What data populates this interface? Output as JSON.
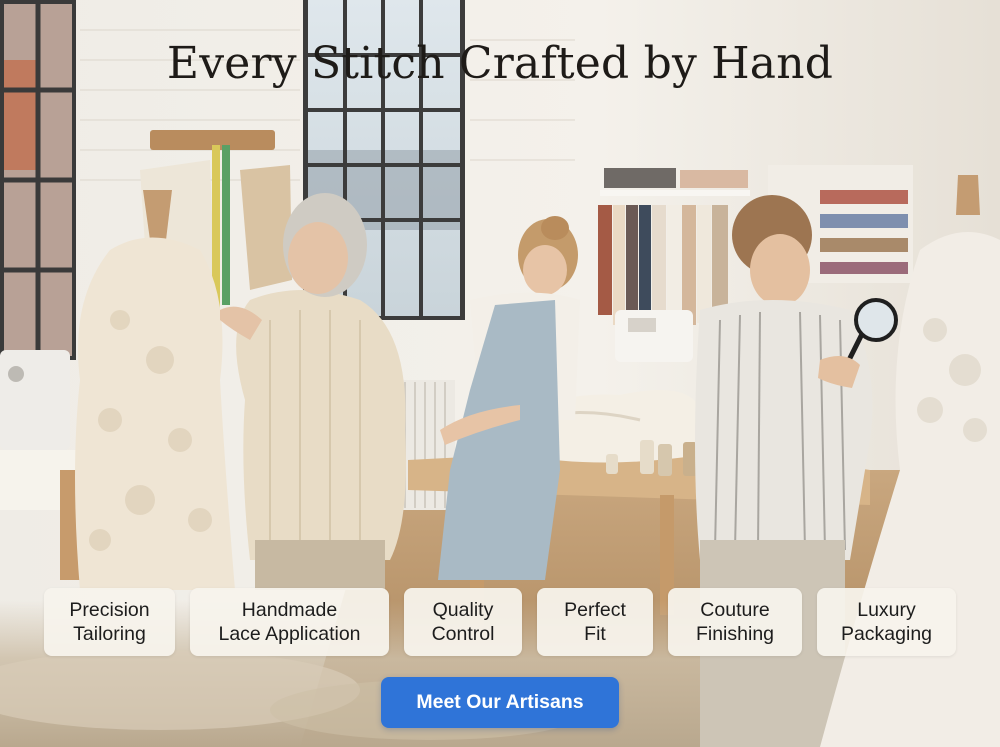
{
  "headline": "Every Stitch Crafted by Hand",
  "chips": [
    {
      "line1": "Precision",
      "line2": "Tailoring"
    },
    {
      "line1": "Handmade",
      "line2": "Lace Application"
    },
    {
      "line1": "Quality",
      "line2": "Control"
    },
    {
      "line1": "Perfect",
      "line2": "Fit"
    },
    {
      "line1": "Couture",
      "line2": "Finishing"
    },
    {
      "line1": "Luxury",
      "line2": "Packaging"
    }
  ],
  "cta_label": "Meet Our Artisans",
  "colors": {
    "cta": "#2f74d8",
    "chip_bg": "#f7f3ec",
    "headline": "#1e1b18"
  }
}
